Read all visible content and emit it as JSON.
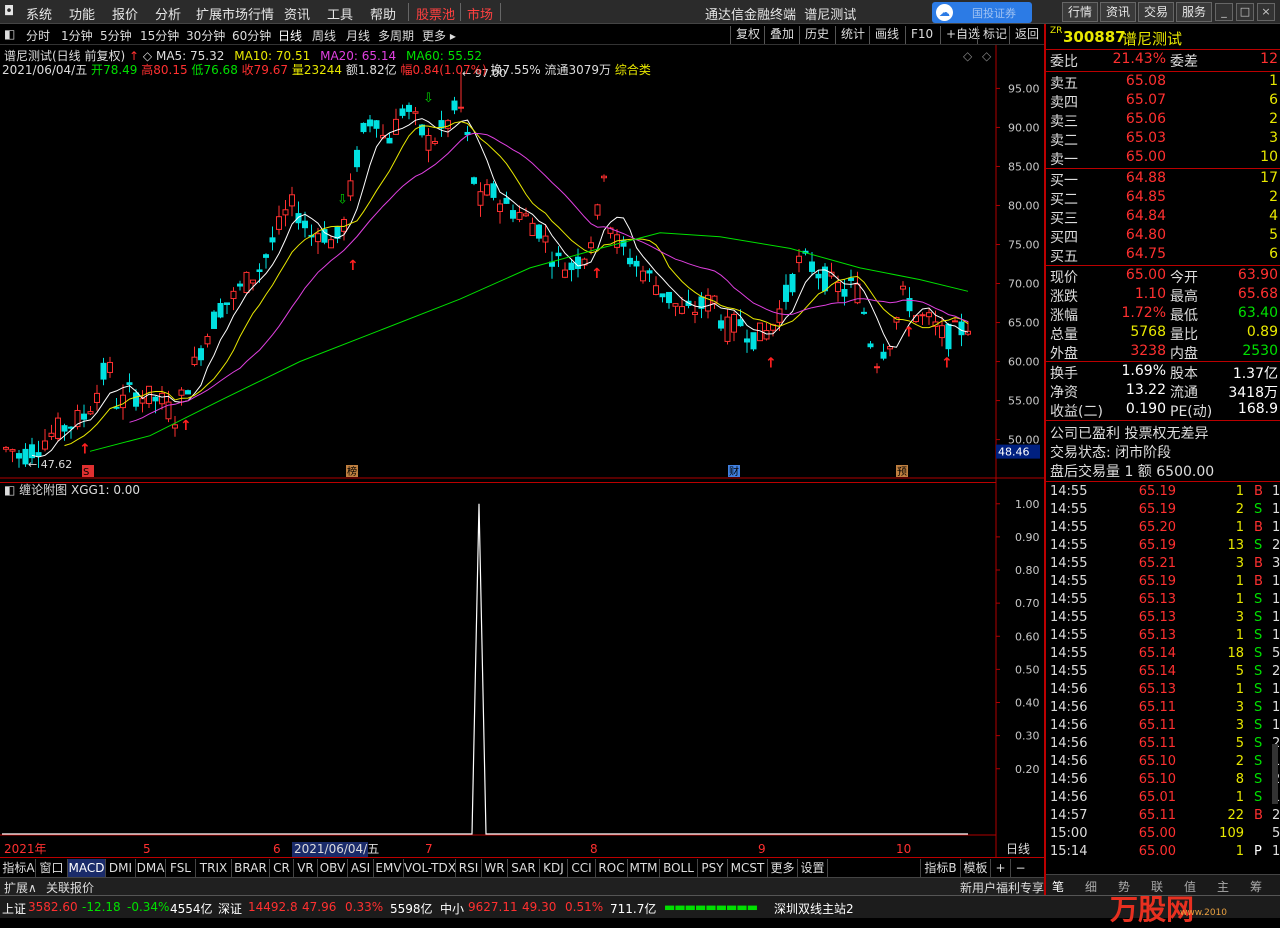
{
  "menu": {
    "items": [
      "系统",
      "功能",
      "报价",
      "分析",
      "扩展市场行情",
      "资讯",
      "工具",
      "帮助"
    ],
    "red_items": [
      "股票池",
      "市场"
    ],
    "title": "通达信金融终端",
    "stock_title": "谱尼测试",
    "cloud_label": "国投证券",
    "right_tabs": [
      "行情",
      "资讯",
      "交易",
      "服务"
    ]
  },
  "toolbar": {
    "periods": [
      "分时",
      "1分钟",
      "5分钟",
      "15分钟",
      "30分钟",
      "60分钟",
      "日线",
      "周线",
      "月线",
      "多周期",
      "更多"
    ],
    "active_period": "日线",
    "right_buttons": [
      "复权",
      "叠加",
      "历史",
      "统计",
      "画线",
      "F10",
      "+自选",
      "标记",
      "返回"
    ]
  },
  "chart_header": {
    "name": "谱尼测试(日线 前复权)",
    "ma5": "MA5: 75.32",
    "ma10": "MA10: 70.51",
    "ma20": "MA20: 65.14",
    "ma60": "MA60: 55.52",
    "date": "2021/06/04/五",
    "open_label": "开",
    "open": "78.49",
    "high_label": "高",
    "high": "80.15",
    "low_label": "低",
    "low": "76.68",
    "close_label": "收",
    "close": "79.67",
    "vol_label": "量",
    "vol": "23244",
    "amt_label": "额",
    "amt": "1.82亿",
    "chg_label": "幅",
    "chg": "0.84(1.07%)",
    "turn": "换7.55%",
    "float": "流通3079万",
    "category": "综合类"
  },
  "price_axis": {
    "ticks": [
      "95.00",
      "90.00",
      "85.00",
      "80.00",
      "75.00",
      "70.00",
      "65.00",
      "60.00",
      "55.00",
      "50.00"
    ],
    "current_tag": "48.46",
    "high_mark": "97.00",
    "low_mark": "47.62"
  },
  "event_marks": [
    "S",
    "榜",
    "财",
    "预"
  ],
  "sub_chart": {
    "title": "缠论附图",
    "value_label": "XGG1: 0.00",
    "ticks": [
      "1.00",
      "0.90",
      "0.80",
      "0.70",
      "0.60",
      "0.50",
      "0.40",
      "0.30",
      "0.20"
    ]
  },
  "x_axis": {
    "labels": [
      "2021年",
      "5",
      "6",
      "2021/06/04/五",
      "7",
      "8",
      "9",
      "10"
    ],
    "period_label": "日线"
  },
  "indicator_tabs": [
    "指标A",
    "窗口",
    "MACD",
    "DMI",
    "DMA",
    "FSL",
    "TRIX",
    "BRAR",
    "CR",
    "VR",
    "OBV",
    "ASI",
    "EMV",
    "VOL-TDX",
    "RSI",
    "WR",
    "SAR",
    "KDJ",
    "CCI",
    "ROC",
    "MTM",
    "BOLL",
    "PSY",
    "MCST",
    "更多",
    "设置"
  ],
  "indicator_right": [
    "指标B",
    "模板",
    "+",
    "−"
  ],
  "sub_bar": {
    "left": [
      "扩展∧",
      "关联报价"
    ],
    "right": "新用户福利专享"
  },
  "status": {
    "sh_label": "上证",
    "sh_val": "3582.60",
    "sh_chg": "-12.18",
    "sh_pct": "-0.34%",
    "sh_amt": "4554亿",
    "sz_label": "深证",
    "sz_val": "14492.8",
    "sz_chg": "47.96",
    "sz_pct": "0.33%",
    "sz_amt": "5598亿",
    "zx_label": "中小",
    "zx_val": "9627.11",
    "zx_chg": "49.30",
    "zx_pct": "0.51%",
    "zx_amt": "711.7亿",
    "server": "深圳双线主站2",
    "watermark": "万股网",
    "watermark_url": "www.2010"
  },
  "quote": {
    "prefix": "ZR",
    "code": "300887",
    "name": "谱尼测试",
    "weibi_label": "委比",
    "weibi": "21.43%",
    "weicha_label": "委差",
    "weicha": "12",
    "asks": [
      {
        "label": "卖五",
        "price": "65.08",
        "vol": "1"
      },
      {
        "label": "卖四",
        "price": "65.07",
        "vol": "6"
      },
      {
        "label": "卖三",
        "price": "65.06",
        "vol": "2"
      },
      {
        "label": "卖二",
        "price": "65.03",
        "vol": "3"
      },
      {
        "label": "卖一",
        "price": "65.00",
        "vol": "10"
      }
    ],
    "bids": [
      {
        "label": "买一",
        "price": "64.88",
        "vol": "17"
      },
      {
        "label": "买二",
        "price": "64.85",
        "vol": "2"
      },
      {
        "label": "买三",
        "price": "64.84",
        "vol": "4"
      },
      {
        "label": "买四",
        "price": "64.80",
        "vol": "5"
      },
      {
        "label": "买五",
        "price": "64.75",
        "vol": "6"
      }
    ],
    "stats": [
      {
        "l1": "现价",
        "v1": "65.00",
        "c1": "red",
        "l2": "今开",
        "v2": "63.90",
        "c2": "red"
      },
      {
        "l1": "涨跌",
        "v1": "1.10",
        "c1": "red",
        "l2": "最高",
        "v2": "65.68",
        "c2": "red"
      },
      {
        "l1": "涨幅",
        "v1": "1.72%",
        "c1": "red",
        "l2": "最低",
        "v2": "63.40",
        "c2": "green"
      },
      {
        "l1": "总量",
        "v1": "5768",
        "c1": "yel",
        "l2": "量比",
        "v2": "0.89",
        "c2": "yel"
      },
      {
        "l1": "外盘",
        "v1": "3238",
        "c1": "red",
        "l2": "内盘",
        "v2": "2530",
        "c2": "green"
      }
    ],
    "stats2": [
      {
        "l1": "换手",
        "v1": "1.69%",
        "l2": "股本",
        "v2": "1.37亿"
      },
      {
        "l1": "净资",
        "v1": "13.22",
        "l2": "流通",
        "v2": "3418万"
      },
      {
        "l1": "收益(二)",
        "v1": "0.190",
        "l2": "PE(动)",
        "v2": "168.9"
      }
    ],
    "info1": "公司已盈利 投票权无差异",
    "info2": "交易状态: 闭市阶段",
    "info3": "盘后交易量 1 额 6500.00"
  },
  "ticks": [
    {
      "t": "14:55",
      "p": "65.19",
      "v": "1",
      "bs": "B",
      "n": "1"
    },
    {
      "t": "14:55",
      "p": "65.19",
      "v": "2",
      "bs": "S",
      "n": "1"
    },
    {
      "t": "14:55",
      "p": "65.20",
      "v": "1",
      "bs": "B",
      "n": "1"
    },
    {
      "t": "14:55",
      "p": "65.19",
      "v": "13",
      "bs": "S",
      "n": "2"
    },
    {
      "t": "14:55",
      "p": "65.21",
      "v": "3",
      "bs": "B",
      "n": "3"
    },
    {
      "t": "14:55",
      "p": "65.19",
      "v": "1",
      "bs": "B",
      "n": "1"
    },
    {
      "t": "14:55",
      "p": "65.13",
      "v": "1",
      "bs": "S",
      "n": "1"
    },
    {
      "t": "14:55",
      "p": "65.13",
      "v": "3",
      "bs": "S",
      "n": "1"
    },
    {
      "t": "14:55",
      "p": "65.13",
      "v": "1",
      "bs": "S",
      "n": "1"
    },
    {
      "t": "14:55",
      "p": "65.14",
      "v": "18",
      "bs": "S",
      "n": "5"
    },
    {
      "t": "14:55",
      "p": "65.14",
      "v": "5",
      "bs": "S",
      "n": "2"
    },
    {
      "t": "14:56",
      "p": "65.13",
      "v": "1",
      "bs": "S",
      "n": "1"
    },
    {
      "t": "14:56",
      "p": "65.11",
      "v": "3",
      "bs": "S",
      "n": "1"
    },
    {
      "t": "14:56",
      "p": "65.11",
      "v": "3",
      "bs": "S",
      "n": "1"
    },
    {
      "t": "14:56",
      "p": "65.11",
      "v": "5",
      "bs": "S",
      "n": "2"
    },
    {
      "t": "14:56",
      "p": "65.10",
      "v": "2",
      "bs": "S",
      "n": "1"
    },
    {
      "t": "14:56",
      "p": "65.10",
      "v": "8",
      "bs": "S",
      "n": "2"
    },
    {
      "t": "14:56",
      "p": "65.01",
      "v": "1",
      "bs": "S",
      "n": "1"
    },
    {
      "t": "14:57",
      "p": "65.11",
      "v": "22",
      "bs": "B",
      "n": "2"
    },
    {
      "t": "15:00",
      "p": "65.00",
      "v": "109",
      "bs": "",
      "n": "54"
    },
    {
      "t": "15:14",
      "p": "65.00",
      "v": "1",
      "bs": "P",
      "n": "1"
    }
  ],
  "bottom_tabs": [
    "笔",
    "细",
    "势",
    "联",
    "值",
    "主",
    "筹"
  ],
  "colors": {
    "up": "#ff3030",
    "down": "#00e0e0",
    "ma5": "#ffffff",
    "ma10": "#e8e800",
    "ma20": "#e040e0",
    "ma60": "#00e000",
    "grid": "#b00000"
  },
  "chart_data": {
    "type": "candlestick",
    "ylim": [
      47,
      98
    ],
    "high": 97.0,
    "low": 47.62,
    "last_close": 65.0,
    "date": "2021/06/04",
    "ma": {
      "MA5": 75.32,
      "MA10": 70.51,
      "MA20": 65.14,
      "MA60": 55.52
    },
    "sub_indicator": {
      "name": "XGG1",
      "ylim": [
        0,
        1.0
      ],
      "peak": 1.0
    }
  }
}
